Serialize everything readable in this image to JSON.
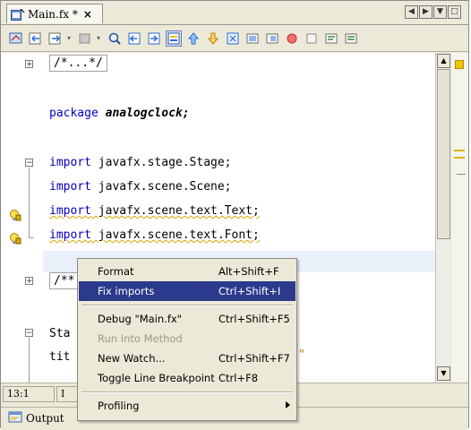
{
  "tab": {
    "title": "Main.fx *",
    "close": "×"
  },
  "nav": {
    "prev": "◀",
    "next": "▶",
    "list": "▼",
    "maximize": "□"
  },
  "toolbar": {
    "icons": [
      "last-edit-icon",
      "back-icon",
      "forward-icon",
      "find-selection-icon",
      "find-previous-icon",
      "find-next-icon",
      "toggle-highlight-icon",
      "previous-bookmark-icon",
      "next-bookmark-icon",
      "toggle-bookmark-icon",
      "shift-left-icon",
      "shift-right-icon",
      "start-macro-icon",
      "stop-macro-icon",
      "comment-icon",
      "uncomment-icon"
    ]
  },
  "editor": {
    "fold_comment": "/*...*/",
    "package_kw": "package",
    "package_name": "analogclock;",
    "imports": [
      {
        "kw": "import",
        "text": "javafx.stage.Stage;"
      },
      {
        "kw": "import",
        "text": "javafx.scene.Scene;"
      },
      {
        "kw": "import",
        "text": "javafx.scene.text.Text;"
      },
      {
        "kw": "import",
        "text": "javafx.scene.text.Font;"
      }
    ],
    "fold_doc": "/**",
    "stage_partial": "Sta",
    "title_partial": "tit",
    "quote_partial": "\""
  },
  "status": {
    "position": "13:1",
    "mode": "I"
  },
  "bottom": {
    "output_label": "Output"
  },
  "menu": {
    "items": [
      {
        "label": "Format",
        "shortcut": "Alt+Shift+F"
      },
      {
        "label": "Fix imports",
        "shortcut": "Ctrl+Shift+I"
      },
      {
        "label": "Debug \"Main.fx\"",
        "shortcut": "Ctrl+Shift+F5"
      },
      {
        "label": "Run Into Method",
        "shortcut": ""
      },
      {
        "label": "New Watch...",
        "shortcut": "Ctrl+Shift+F7"
      },
      {
        "label": "Toggle Line Breakpoint",
        "shortcut": "Ctrl+F8"
      },
      {
        "label": "Profiling",
        "shortcut": ""
      }
    ]
  },
  "colors": {
    "keyword": "#0000c0",
    "menu_highlight": "#2b3a8c",
    "warning": "#e1b400"
  }
}
